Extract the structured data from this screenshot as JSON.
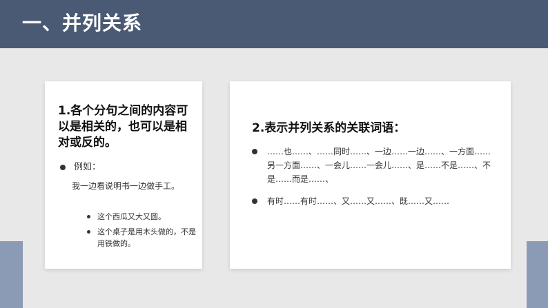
{
  "header": {
    "title": "一、并列关系"
  },
  "left_card": {
    "heading": "1.各个分句之间的内容可以是相关的，也可以是相对或反的。",
    "bullet": "例如：",
    "paragraph": "我一边看说明书一边做手工。",
    "sub_bullets": [
      "这个西瓜又大又圆。",
      "这个桌子是用木头做的，不是用铁做的。"
    ]
  },
  "right_card": {
    "heading": "2.表示并列关系的关联词语：",
    "bullets": [
      "……也……、……同时……、一边……一边……、一方面……另一方面……、一会儿……一会儿……、是……不是……、不是……而是……、",
      "有时……有时……、又……又……、既……又……"
    ]
  }
}
